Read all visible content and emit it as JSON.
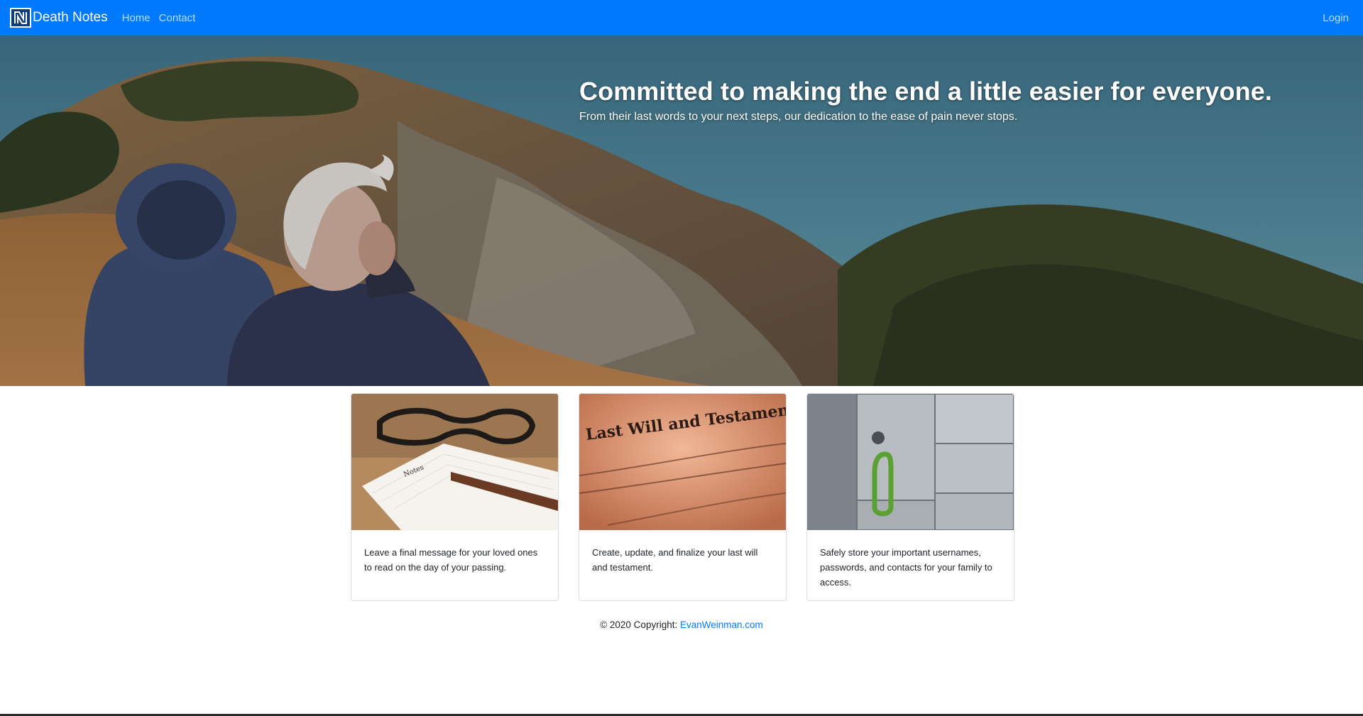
{
  "nav": {
    "brand": "Death Notes",
    "links": [
      "Home",
      "Contact"
    ],
    "login": "Login"
  },
  "hero": {
    "title": "Committed to making the end a little easier for everyone.",
    "subtitle": "From their last words to your next steps, our dedication to the ease of pain never stops."
  },
  "cards": [
    {
      "text": "Leave a final message for your loved ones to read on the day of your passing.",
      "image_label": "Notes"
    },
    {
      "text": "Create, update, and finalize your last will and testament.",
      "image_label": "Last Will and Testament"
    },
    {
      "text": "Safely store your important usernames, passwords, and contacts for your family to access.",
      "image_label": ""
    }
  ],
  "footer": {
    "prefix": "© 2020 Copyright: ",
    "link": "EvanWeinman.com"
  },
  "colors": {
    "navbar": "#007bff",
    "link": "#007bff"
  }
}
